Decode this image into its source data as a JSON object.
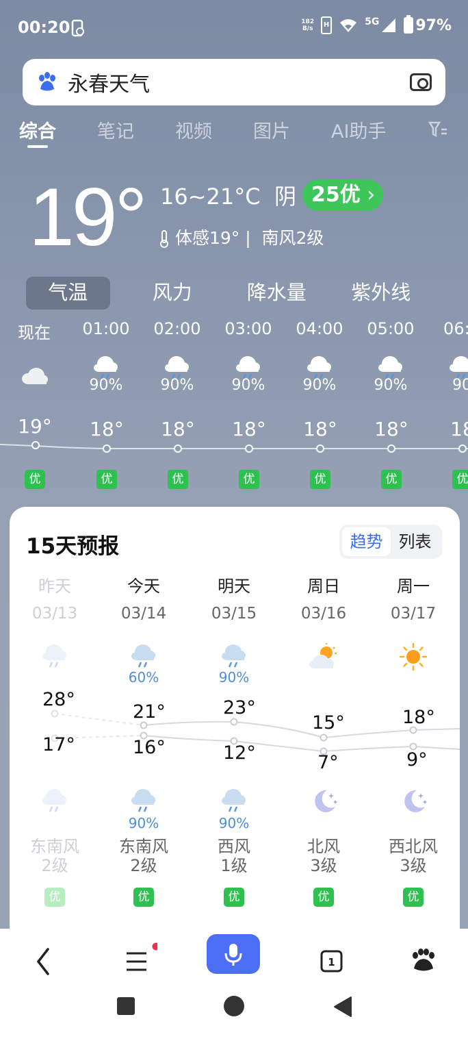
{
  "status": {
    "time": "00:20",
    "net_speed_top": "182",
    "net_speed_bottom": "B/s",
    "signal": "5G",
    "battery": "97%"
  },
  "search": {
    "query": "永春天气"
  },
  "tabs": [
    "综合",
    "笔记",
    "视频",
    "图片",
    "AI助手"
  ],
  "current": {
    "temp": "19°",
    "range": "16~21°C",
    "condition": "阴",
    "aqi": "25优",
    "feels": "体感19°",
    "wind": "南风2级"
  },
  "metric_tabs": [
    "气温",
    "风力",
    "降水量",
    "紫外线"
  ],
  "hourly": [
    {
      "time": "现在",
      "icon": "cloudy-icon",
      "prob": "",
      "temp": "19°",
      "aqi": "优"
    },
    {
      "time": "01:00",
      "icon": "rain-icon",
      "prob": "90%",
      "temp": "18°",
      "aqi": "优"
    },
    {
      "time": "02:00",
      "icon": "rain-icon",
      "prob": "90%",
      "temp": "18°",
      "aqi": "优"
    },
    {
      "time": "03:00",
      "icon": "rain-icon",
      "prob": "90%",
      "temp": "18°",
      "aqi": "优"
    },
    {
      "time": "04:00",
      "icon": "rain-icon",
      "prob": "90%",
      "temp": "18°",
      "aqi": "优"
    },
    {
      "time": "05:00",
      "icon": "rain-icon",
      "prob": "90%",
      "temp": "18°",
      "aqi": "优"
    },
    {
      "time": "06:0",
      "icon": "rain-icon",
      "prob": "90",
      "temp": "18",
      "aqi": "优"
    }
  ],
  "forecast": {
    "title": "15天预报",
    "toggle": [
      "趋势",
      "列表"
    ],
    "days": [
      {
        "name": "昨天",
        "date": "03/13",
        "day_icon": "rain-icon",
        "day_prob": "",
        "high": "28°",
        "low": "17°",
        "night_icon": "rain-icon",
        "night_prob": "",
        "wind_dir": "东南风",
        "wind_level": "2级",
        "aqi": "优",
        "past": true
      },
      {
        "name": "今天",
        "date": "03/14",
        "day_icon": "rain-icon",
        "day_prob": "60%",
        "high": "21°",
        "low": "16°",
        "night_icon": "rain-icon",
        "night_prob": "90%",
        "wind_dir": "东南风",
        "wind_level": "2级",
        "aqi": "优",
        "past": false
      },
      {
        "name": "明天",
        "date": "03/15",
        "day_icon": "rain-icon",
        "day_prob": "90%",
        "high": "23°",
        "low": "12°",
        "night_icon": "rain-icon",
        "night_prob": "90%",
        "wind_dir": "西风",
        "wind_level": "1级",
        "aqi": "优",
        "past": false
      },
      {
        "name": "周日",
        "date": "03/16",
        "day_icon": "partly-sunny-icon",
        "day_prob": "",
        "high": "15°",
        "low": "7°",
        "night_icon": "moon-icon",
        "night_prob": "",
        "wind_dir": "北风",
        "wind_level": "3级",
        "aqi": "优",
        "past": false
      },
      {
        "name": "周一",
        "date": "03/17",
        "day_icon": "sun-icon",
        "day_prob": "",
        "high": "18°",
        "low": "9°",
        "night_icon": "moon-icon",
        "night_prob": "",
        "wind_dir": "西北风",
        "wind_level": "3级",
        "aqi": "优",
        "past": false
      }
    ]
  },
  "colors": {
    "aqi_green": "#2fc150",
    "pill_green": "#3ec65a",
    "accent_blue": "#4c6ef5",
    "prob_blue": "#4d8ed9"
  }
}
